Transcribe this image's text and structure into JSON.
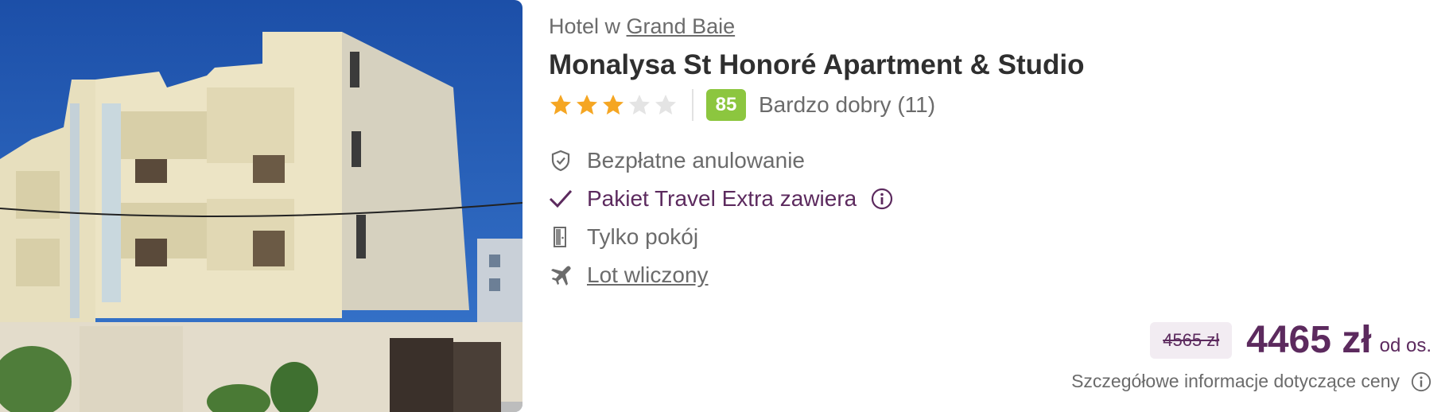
{
  "hotel": {
    "location_prefix": "Hotel w",
    "location_link": "Grand Baie",
    "name": "Monalysa St Honoré Apartment & Studio",
    "stars": {
      "filled": 3,
      "total": 5
    },
    "score": "85",
    "rating_text": "Bardzo dobry (11)"
  },
  "features": [
    {
      "icon": "shield-check-icon",
      "label": "Bezpłatne anulowanie"
    },
    {
      "icon": "checkmark-icon",
      "label": "Pakiet Travel Extra zawiera",
      "info": "info-icon"
    },
    {
      "icon": "door-icon",
      "label": "Tylko pokój"
    },
    {
      "icon": "plane-icon",
      "label": "Lot wliczony"
    }
  ],
  "price": {
    "old": "4565 zł",
    "current": "4465 zł",
    "per": "od os.",
    "details_link": "Szczegółowe informacje dotyczące ceny"
  },
  "colors": {
    "accent_purple": "#5c2a5e",
    "score_green": "#8cc63f",
    "star_gold": "#f5a623",
    "text_gray": "#6b6b6b"
  }
}
